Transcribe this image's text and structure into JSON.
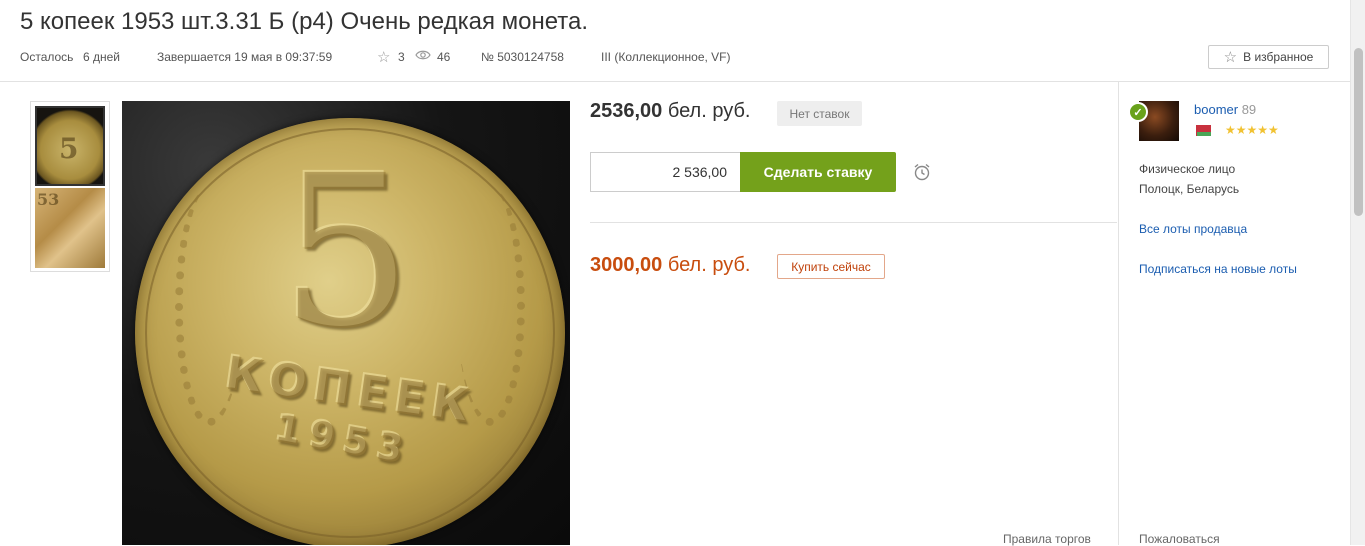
{
  "lot": {
    "title": "5 копеек 1953 шт.3.31 Б (р4) Очень редкая монета.",
    "remaining_label": "Осталось",
    "remaining_value": "6 дней",
    "ends": "Завершается 19 мая в 09:37:59",
    "stars_count": "3",
    "views_count": "46",
    "lot_number": "№ 5030124758",
    "condition": "III (Коллекционное, VF)",
    "favorite_label": "В избранное"
  },
  "gallery": {
    "thumbs": [
      "coin-obverse-thumb",
      "coin-detail-thumb"
    ]
  },
  "bid": {
    "current_price": "2536,00",
    "currency": "бел. руб.",
    "no_bids_label": "Нет ставок",
    "input_value": "2 536,00",
    "bid_button_label": "Сделать ставку"
  },
  "buy_now": {
    "price": "3000,00",
    "currency": "бел. руб.",
    "button_label": "Купить сейчас"
  },
  "footer": {
    "rules_label": "Правила торгов",
    "complain_label": "Пожаловаться"
  },
  "seller": {
    "name": "boomer",
    "score": "89",
    "stars": "★★★★★",
    "type": "Физическое лицо",
    "location": "Полоцк, Беларусь",
    "all_lots_link": "Все лоты продавца",
    "subscribe_link": "Подписаться на новые лоты",
    "verified_icon": "check-icon"
  },
  "colors": {
    "bid_button": "#74a11b",
    "buy_price": "#c84d0e",
    "link": "#1b5db0",
    "rating_star": "#f1c232"
  }
}
